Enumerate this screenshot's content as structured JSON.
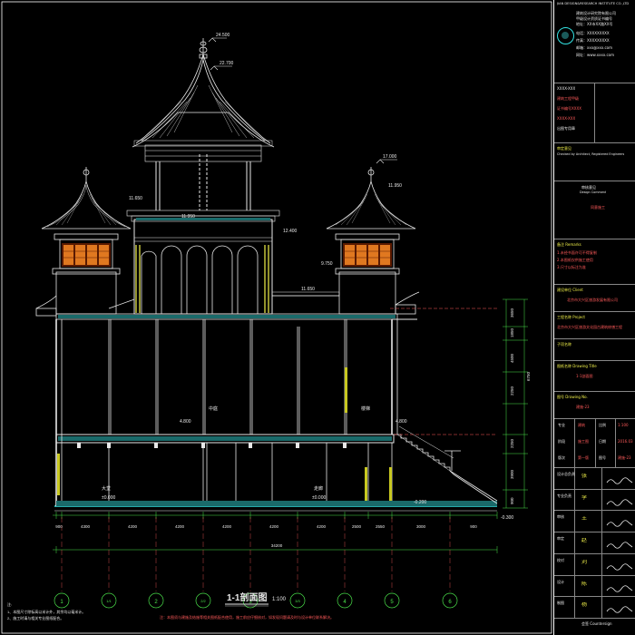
{
  "section_title": "1-1剖面图",
  "scale": "1:100",
  "axis_labels": [
    "1",
    "1/1",
    "2",
    "2/2",
    "3",
    "3/3",
    "4",
    "5",
    "6"
  ],
  "bottom_dims": [
    "900",
    "4300",
    "4200",
    "4200",
    "4200",
    "4200",
    "4200",
    "2500",
    "2550",
    "3000",
    "900"
  ],
  "total_dim": "34200",
  "elevations": {
    "top": "24.500",
    "roof_ridge": "22.700",
    "tower_top": "17.000",
    "lv_11": "11.650",
    "lv_11b": "11.950",
    "lv_12": "12.400",
    "lv_9": "9.750",
    "lv_4": "4.800",
    "lv_4b": "4.800",
    "zero": "±0.000",
    "zero2": "±0.000",
    "neg": "-0.200",
    "neg_right": "-0.300"
  },
  "right_dims": [
    "3650",
    "1850",
    "4500",
    "2250",
    "6750",
    "2250",
    "3900",
    "900"
  ],
  "room_labels": {
    "lobby": "大堂",
    "stair": "楼梯",
    "upper_hall": "中庭",
    "corridor": "走廊"
  },
  "notes_title": "注:",
  "notes": [
    "1、本图尺寸除标高以米计外，其余均以毫米计。",
    "2、施工时请与相关专业图纸配合。"
  ],
  "red_note": "注：本图须与建施及结施等相关图纸配合使用，施工前应仔细核对，如发现问题请及时与设计单位联系解决。",
  "title_block": {
    "company_en": "JIAN DESIGN&RESEARCH INSTITUTE CO.,LTD",
    "company_lines": [
      "建筑设计研究院有限公司",
      "甲级设计资质证书编号",
      "地址：XX市XX路XX号",
      "电话：XXXXXXXXX",
      "传真：XXXXXXXXX",
      "邮箱：xxx@xxx.com",
      "网址：www.xxxx.com"
    ],
    "cert_rows": [
      "XXXX-XXX",
      "建筑工程甲级",
      "证书编号XXXX"
    ],
    "seal_text": "出图专用章",
    "approval": "审定意见",
    "approval_sub": "Checked by Architect, Registered Engineers",
    "review_title": "审核意见",
    "review_sub": "Design Comment",
    "review_red": "同意施工",
    "notes_label": "备注 Remarks",
    "remarks": [
      "1.未经书面许可不得复制",
      "2.本图纸仅供施工使用",
      "3.尺寸以标注为准"
    ],
    "client_label": "建设单位 Client",
    "client": "北京市大兴区旅游发展有限公司",
    "project_label": "工程名称 Project",
    "project": "北京市大兴区旅游文化园古建筑修缮工程",
    "sub_label": "子项名称",
    "drawing_label": "图纸名称 Drawing Title",
    "drawing_title": "1-1剖面图",
    "drawing_no_label": "图号 Drawing No.",
    "drawing_no": "建施-23",
    "grid_rows": [
      [
        "专业",
        "建筑",
        "比例",
        "1:100"
      ],
      [
        "阶段",
        "施工图",
        "日期",
        "2016.03"
      ],
      [
        "版次",
        "第一版",
        "图号",
        "建施-23"
      ]
    ],
    "sign_roles": [
      "设计总负责",
      "专业负责",
      "审核",
      "审定",
      "校对",
      "设计",
      "制图"
    ],
    "sign_names": [
      "张",
      "李",
      "王",
      "赵",
      "刘",
      "陈",
      "杨"
    ],
    "footer": "会签 Countersign"
  }
}
